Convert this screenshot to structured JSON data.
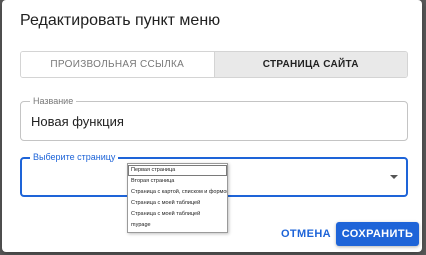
{
  "dialog": {
    "title": "Редактировать пункт меню",
    "tabs": [
      {
        "label": "ПРОИЗВОЛЬНАЯ ССЫЛКА",
        "active": false
      },
      {
        "label": "СТРАНИЦА САЙТА",
        "active": true
      }
    ],
    "name_field": {
      "label": "Название",
      "value": "Новая функция"
    },
    "page_field": {
      "label": "Выберите страницу",
      "value": ""
    },
    "page_options": [
      "Первая страница",
      "Вторая страница",
      "Страница с картой, списком и формой",
      "Страница с моей таблицей",
      "Страница с моей таблицей",
      "mypage"
    ],
    "buttons": {
      "cancel": "ОТМЕНА",
      "save": "СОХРАНИТЬ"
    }
  },
  "colors": {
    "accent": "#1e64d8",
    "overlay": "#5a5a5a"
  },
  "icons": {
    "dropdown_arrow": "arrow-drop-down-icon"
  }
}
